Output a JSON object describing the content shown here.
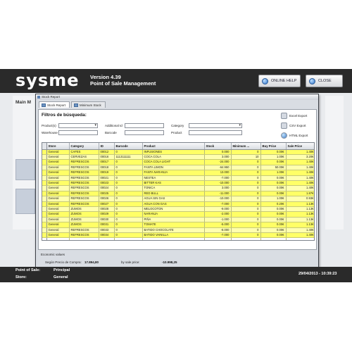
{
  "app": {
    "logo": "sysme",
    "version": "Version  4.39",
    "subtitle": "Point of Sale Management",
    "online_help": "ONLINE HELP",
    "close": "CLOSE"
  },
  "background": {
    "panel_title": "Main M"
  },
  "window": {
    "title": "Stock Report",
    "tabs": [
      {
        "label": "Stock Report"
      },
      {
        "label": "Minimum Stock"
      }
    ]
  },
  "filters": {
    "title": "Filtros de búsqueda:",
    "labels": {
      "product": "Product(s)",
      "additional": "Additional Id",
      "category": "Category",
      "warehouse": "Warehouse",
      "barcode": "Barcode",
      "product2": "Product"
    }
  },
  "export": {
    "excel": "Excel Export",
    "csv": "CSV Export",
    "html": "HTML Export"
  },
  "table": {
    "columns": [
      "Store",
      "Category",
      "ID",
      "Barcode",
      "Product",
      "Stock",
      "Minimum ...",
      "Buy Price",
      "Sale Price"
    ],
    "rows": [
      [
        "General",
        "CAFES",
        "00012",
        "0",
        "INFUSIONES",
        "0.000",
        "0",
        "0.00€",
        "1.40€"
      ],
      [
        "General",
        "CERVEZAS",
        "00016",
        "1113111111",
        "COCA COLA",
        "3.000",
        "10",
        "1.00€",
        "3.20€"
      ],
      [
        "General",
        "REFRESCOS",
        "00017",
        "0",
        "COCA COLA LIGHT",
        "-24.000",
        "0",
        "0.00€",
        "1.40€"
      ],
      [
        "General",
        "REFRESCOS",
        "00018",
        "0",
        "FANTA LIMON",
        "-64.950",
        "0",
        "50.00€",
        "1.40€"
      ],
      [
        "General",
        "REFRESCOS",
        "00019",
        "0",
        "FANTA NARANJA",
        "13.000",
        "0",
        "1.00€",
        "1.40€"
      ],
      [
        "General",
        "REFRESCOS",
        "00021",
        "0",
        "NESTEA",
        "-7.000",
        "0",
        "0.00€",
        "1.40€"
      ],
      [
        "General",
        "REFRESCOS",
        "00023",
        "0",
        "BITTER KAS",
        "-10.000",
        "0",
        "0.00€",
        "1.40€"
      ],
      [
        "General",
        "REFRESCOS",
        "00024",
        "0",
        "TONICA",
        "3.000",
        "0",
        "0.00€",
        "1.40€"
      ],
      [
        "General",
        "REFRESCOS",
        "00025",
        "0",
        "RED BULL",
        "-11.000",
        "0",
        "0.00€",
        "1.87€"
      ],
      [
        "General",
        "REFRESCOS",
        "00026",
        "0",
        "AGUA SIN GAS",
        "-10.000",
        "0",
        "1.00€",
        "0.93€"
      ],
      [
        "General",
        "REFRESCOS",
        "00027",
        "0",
        "AGUA CON GAS",
        "-7.000",
        "0",
        "0.20€",
        "1.13€"
      ],
      [
        "General",
        "ZUMOS",
        "00028",
        "0",
        "MELOCOTON",
        "-9.000",
        "0",
        "0.00€",
        "1.13€"
      ],
      [
        "General",
        "ZUMOS",
        "00029",
        "0",
        "NARANJA",
        "-2.000",
        "0",
        "0.00€",
        "1.13€"
      ],
      [
        "General",
        "ZUMOS",
        "00030",
        "0",
        "PIÑA",
        "-1.000",
        "0",
        "0.00€",
        "1.13€"
      ],
      [
        "General",
        "ZUMOS",
        "00031",
        "0",
        "TOMATE",
        "-5.000",
        "0",
        "0.00€",
        "1.13€"
      ],
      [
        "General",
        "REFRESCOS",
        "00033",
        "0",
        "BATIDO CHOCOLATE",
        "-8.000",
        "0",
        "0.00€",
        "1.40€"
      ],
      [
        "General",
        "REFRESCOS",
        "00034",
        "0",
        "BATIDO VAINILLA",
        "-7.000",
        "0",
        "0.00€",
        "1.40€"
      ],
      [
        "",
        "",
        "",
        "",
        "",
        "",
        "",
        "",
        ""
      ]
    ]
  },
  "economic": {
    "title": "Economic values",
    "buy_label": "Según Precio de Compra:",
    "buy_value": "17.894,80",
    "sale_label": "by sale price:",
    "sale_value": "-10.998,25"
  },
  "footer": {
    "pos_label": "Point of Sale:",
    "pos_value": "Principal",
    "store_label": "Store:",
    "store_value": "General",
    "datetime": "29/04/2013 - 10:39:23"
  }
}
